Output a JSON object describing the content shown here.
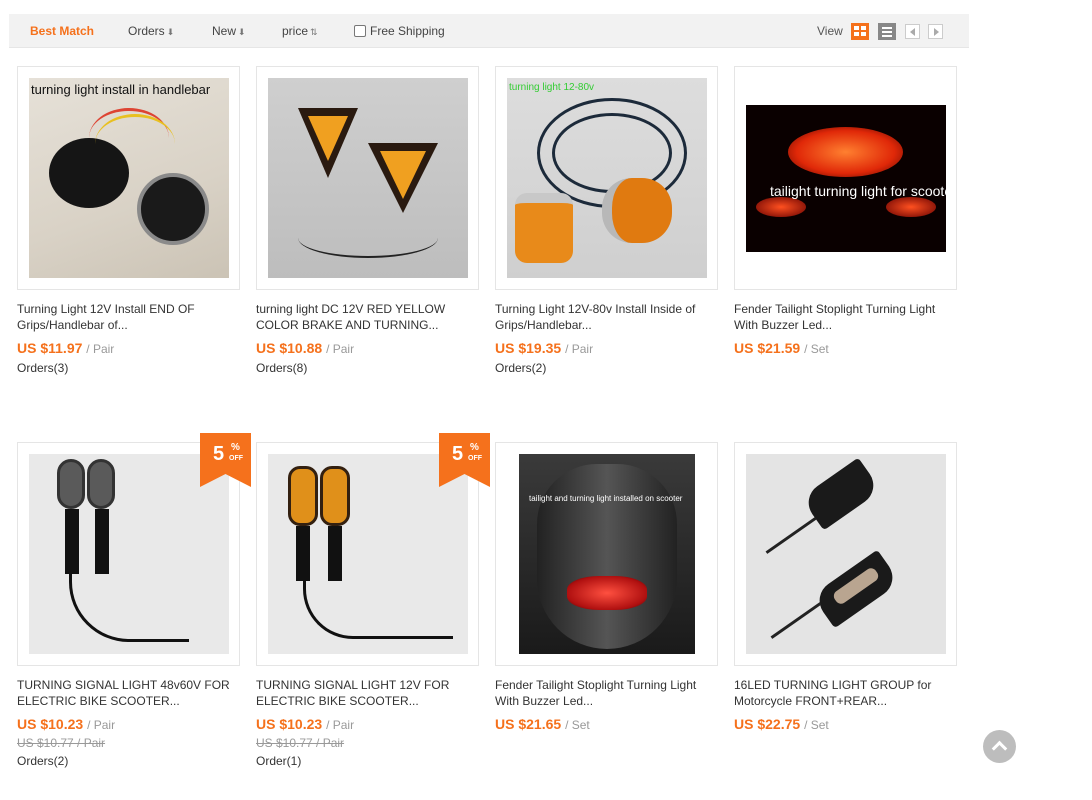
{
  "sortbar": {
    "best_match": "Best Match",
    "orders": "Orders",
    "new": "New",
    "price": "price",
    "free_shipping": "Free Shipping",
    "view_label": "View",
    "arrow": "⬇",
    "price_arrows": "⇅"
  },
  "colors": {
    "accent": "#f5711c",
    "muted": "#999999",
    "sortbar_bg": "#f2f2f2"
  },
  "products": [
    {
      "title": "Turning Light 12V Install END OF Grips/Handlebar of...",
      "price": "US $11.97",
      "unit": "/ Pair",
      "orders": "Orders(3)",
      "image_text": "turning light install in handlebar"
    },
    {
      "title": "turning light DC 12V RED YELLOW COLOR BRAKE AND TURNING...",
      "price": "US $10.88",
      "unit": "/ Pair",
      "orders": "Orders(8)"
    },
    {
      "title": "Turning Light 12V-80v Install Inside of Grips/Handlebar...",
      "price": "US $19.35",
      "unit": "/ Pair",
      "orders": "Orders(2)",
      "image_text": "turning light 12-80v"
    },
    {
      "title": "Fender Tailight Stoplight Turning Light With Buzzer Led...",
      "price": "US $21.59",
      "unit": "/ Set",
      "image_text": "tailight turning light for scooter"
    },
    {
      "title": "TURNING SIGNAL LIGHT 48v60V FOR ELECTRIC BIKE SCOOTER...",
      "price": "US $10.23",
      "unit": "/ Pair",
      "old_price": "US $10.77 / Pair",
      "orders": "Orders(2)",
      "discount": "5",
      "discount_pct": "%",
      "discount_off": "OFF"
    },
    {
      "title": "TURNING SIGNAL LIGHT 12V FOR ELECTRIC BIKE SCOOTER...",
      "price": "US $10.23",
      "unit": "/ Pair",
      "old_price": "US $10.77 / Pair",
      "orders": "Order(1)",
      "discount": "5",
      "discount_pct": "%",
      "discount_off": "OFF"
    },
    {
      "title": "Fender Tailight Stoplight Turning Light With Buzzer Led...",
      "price": "US $21.65",
      "unit": "/ Set",
      "image_text": "tailight and turning light installed on scooter"
    },
    {
      "title": "16LED TURNING LIGHT GROUP for Motorcycle FRONT+REAR...",
      "price": "US $22.75",
      "unit": "/ Set"
    }
  ]
}
